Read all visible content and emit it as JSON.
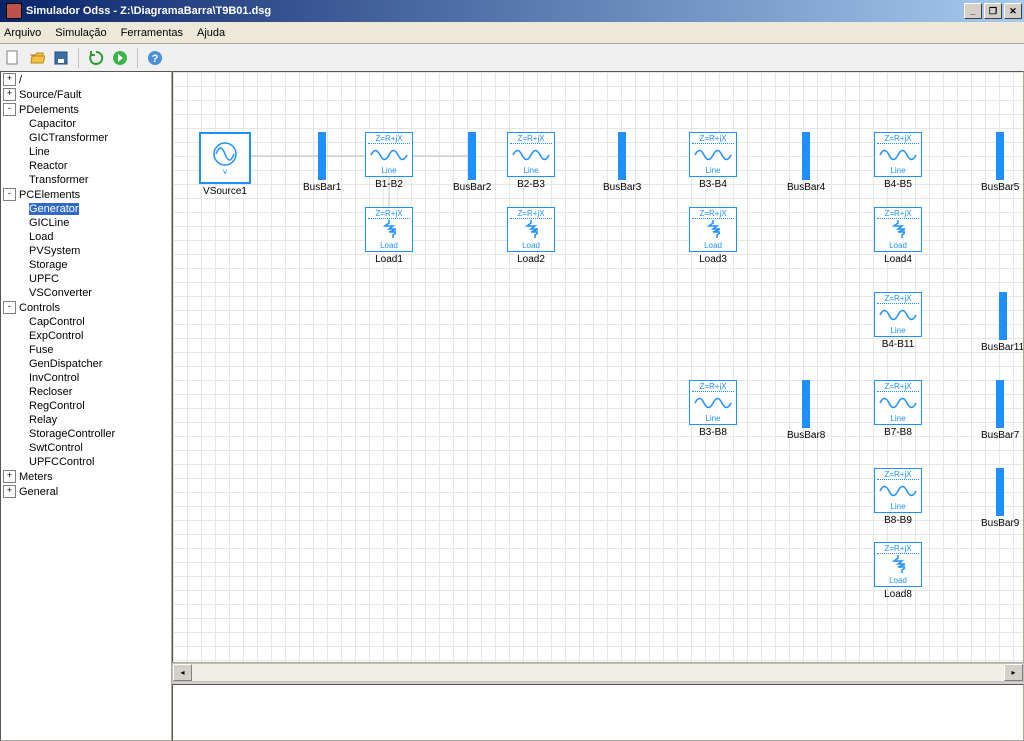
{
  "title": "Simulador Odss - Z:\\DiagramaBarra\\T9B01.dsg",
  "menu": {
    "arquivo": "Arquivo",
    "simulacao": "Simulação",
    "ferramentas": "Ferramentas",
    "ajuda": "Ajuda"
  },
  "tree": {
    "root": "/",
    "sourcefault": "Source/Fault",
    "pdelements": "PDelements",
    "pd": {
      "capacitor": "Capacitor",
      "gictransformer": "GICTransformer",
      "line": "Line",
      "reactor": "Reactor",
      "transformer": "Transformer"
    },
    "pcelements": "PCElements",
    "pc": {
      "generator": "Generator",
      "gicline": "GICLine",
      "load": "Load",
      "pvsystem": "PVSystem",
      "storage": "Storage",
      "upfc": "UPFC",
      "vsconverter": "VSConverter"
    },
    "controls": "Controls",
    "ctl": {
      "capcontrol": "CapControl",
      "expcontrol": "ExpControl",
      "fuse": "Fuse",
      "gendispatcher": "GenDispatcher",
      "invcontrol": "InvControl",
      "recloser": "Recloser",
      "regcontrol": "RegControl",
      "relay": "Relay",
      "storagecontroller": "StorageController",
      "swtcontrol": "SwtControl",
      "upfccontrol": "UPFCControl"
    },
    "meters": "Meters",
    "general": "General"
  },
  "block": {
    "imp_hdr": "Z=R+jX",
    "line_ft": "Line",
    "load_ft": "Load",
    "vsub": "v"
  },
  "diag": {
    "vsource": "VSource1",
    "busbar1": "BusBar1",
    "busbar2": "BusBar2",
    "busbar3": "BusBar3",
    "busbar4": "BusBar4",
    "busbar5": "BusBar5",
    "busbar7": "BusBar7",
    "busbar8": "BusBar8",
    "busbar9": "BusBar9",
    "busbar11": "BusBar11",
    "b1b2": "B1-B2",
    "b2b3": "B2-B3",
    "b3b4": "B3-B4",
    "b4b5": "B4-B5",
    "b3b8": "B3-B8",
    "b4b11": "B4-B11",
    "b7b8": "B7-B8",
    "b8b9": "B8-B9",
    "load1": "Load1",
    "load2": "Load2",
    "load3": "Load3",
    "load4": "Load4",
    "load8": "Load8"
  }
}
